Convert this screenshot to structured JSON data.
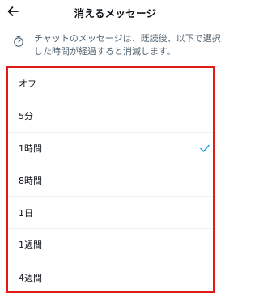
{
  "header": {
    "title": "消えるメッセージ",
    "back_icon": "arrow-left-icon"
  },
  "info": {
    "icon": "timer-icon",
    "text": "チャットのメッセージは、既読後、以下で選択した時間が経過すると消滅します。"
  },
  "options": [
    {
      "label": "オフ",
      "selected": false
    },
    {
      "label": "5分",
      "selected": false
    },
    {
      "label": "1時間",
      "selected": true
    },
    {
      "label": "8時間",
      "selected": false
    },
    {
      "label": "1日",
      "selected": false
    },
    {
      "label": "1週間",
      "selected": false
    },
    {
      "label": "4週間",
      "selected": false
    }
  ],
  "colors": {
    "accent": "#1d9bf0",
    "highlight_border": "#e11a1a",
    "secondary_text": "#536471"
  }
}
